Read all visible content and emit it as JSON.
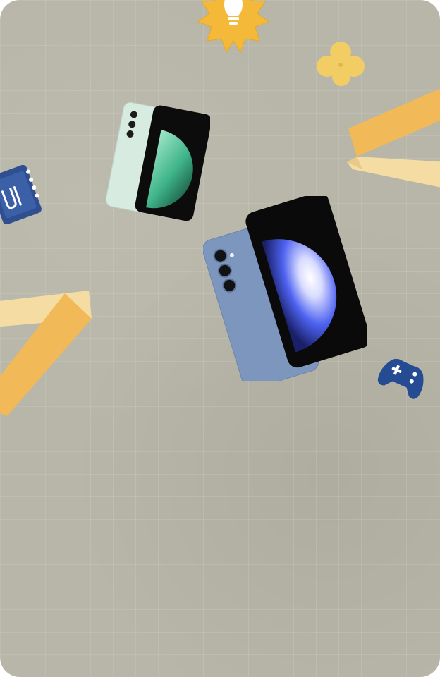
{
  "background": {
    "color": "#b7b6a8",
    "pattern": "grid-paper"
  },
  "stickers": [
    {
      "name": "sun-bulb",
      "color": "#f4b938",
      "accent": "#ffffff"
    },
    {
      "name": "clover",
      "color": "#f1cd63"
    },
    {
      "name": "notebook",
      "color": "#2f4f91"
    },
    {
      "name": "gamepad",
      "color": "#254c93"
    },
    {
      "name": "ribbon",
      "color": "#f1b957",
      "accent": "#f4dca3"
    }
  ],
  "phones": [
    {
      "name": "mint-phone",
      "body_color": "#d7ebe1",
      "screen_color": "#3fb48a"
    },
    {
      "name": "blue-phone",
      "body_color": "#7d96be",
      "screen_color": "#4d62f0"
    }
  ]
}
